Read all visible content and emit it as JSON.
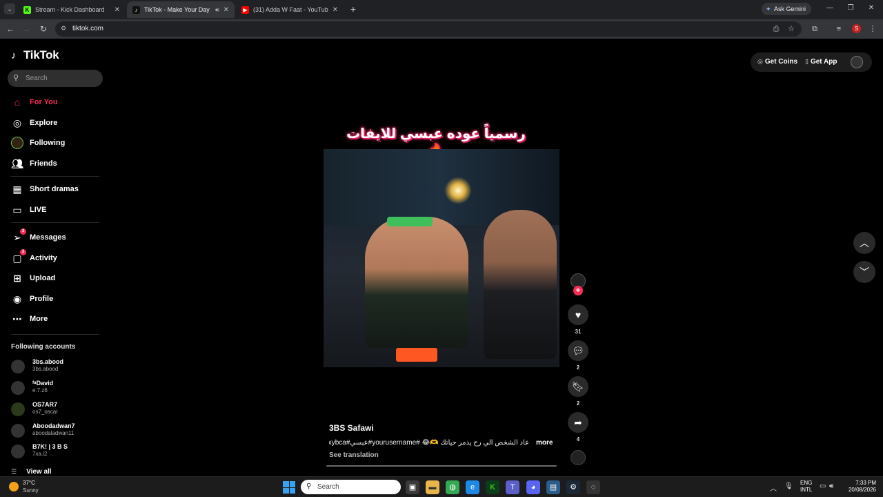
{
  "browser": {
    "tabs": [
      {
        "label": "Stream - Kick Dashboard",
        "icon": "kick-favicon",
        "color": "#53fc18"
      },
      {
        "label": "TikTok - Make Your Day",
        "icon": "tiktok-favicon",
        "active": true
      },
      {
        "label": "(31) Adda W Faat - YouTube",
        "icon": "youtube-favicon",
        "color": "#ff0000"
      }
    ],
    "ask_gemini": "Ask Gemini",
    "url": "tiktok.com",
    "profile_initial": "S"
  },
  "tiktok": {
    "logo": "TikTok",
    "search_placeholder": "Search",
    "nav": [
      {
        "label": "For You",
        "icon": "home-icon",
        "active": true
      },
      {
        "label": "Explore",
        "icon": "compass-icon"
      },
      {
        "label": "Following",
        "icon": "following-avatar"
      },
      {
        "label": "Friends",
        "icon": "friends-icon"
      },
      {
        "label": "Short dramas",
        "icon": "drama-icon"
      },
      {
        "label": "LIVE",
        "icon": "live-icon"
      },
      {
        "label": "Messages",
        "icon": "messages-icon",
        "badge": "3"
      },
      {
        "label": "Activity",
        "icon": "activity-icon",
        "badge": "3"
      },
      {
        "label": "Upload",
        "icon": "upload-icon"
      },
      {
        "label": "Profile",
        "icon": "profile-icon"
      },
      {
        "label": "More",
        "icon": "more-icon"
      }
    ],
    "following_accounts_title": "Following accounts",
    "accounts": [
      {
        "name": "3bs.abood",
        "handle": "3bs.abood"
      },
      {
        "name": "ᶠᵃDavid",
        "handle": "e.7.z6"
      },
      {
        "name": "OS7AR7",
        "handle": "os7_oscar"
      },
      {
        "name": "Aboodadwan7",
        "handle": "aboodaladwan11"
      },
      {
        "name": "B7K! | 3 B S",
        "handle": "7xa.i2"
      }
    ],
    "view_all": "View all",
    "top_actions": {
      "get_coins": "Get Coins",
      "get_app": "Get App"
    },
    "video": {
      "overlay_caption": "رسمياً عوده عبسي للايفات🔥",
      "creator": "3BS Safawi",
      "description": "عاد الشخص الي رح يدمر حياتك 🫶😂 #yourusername#عبسي#xybca...",
      "more": "more",
      "see_translation": "See translation",
      "likes": "31",
      "comments": "2",
      "saves": "2",
      "shares": "4"
    }
  },
  "taskbar": {
    "temp": "37°C",
    "condition": "Sunny",
    "search_placeholder": "Search",
    "lang_top": "ENG",
    "lang_bottom": "INTL",
    "time": "7:33 PM",
    "date": "20/08/2026"
  }
}
